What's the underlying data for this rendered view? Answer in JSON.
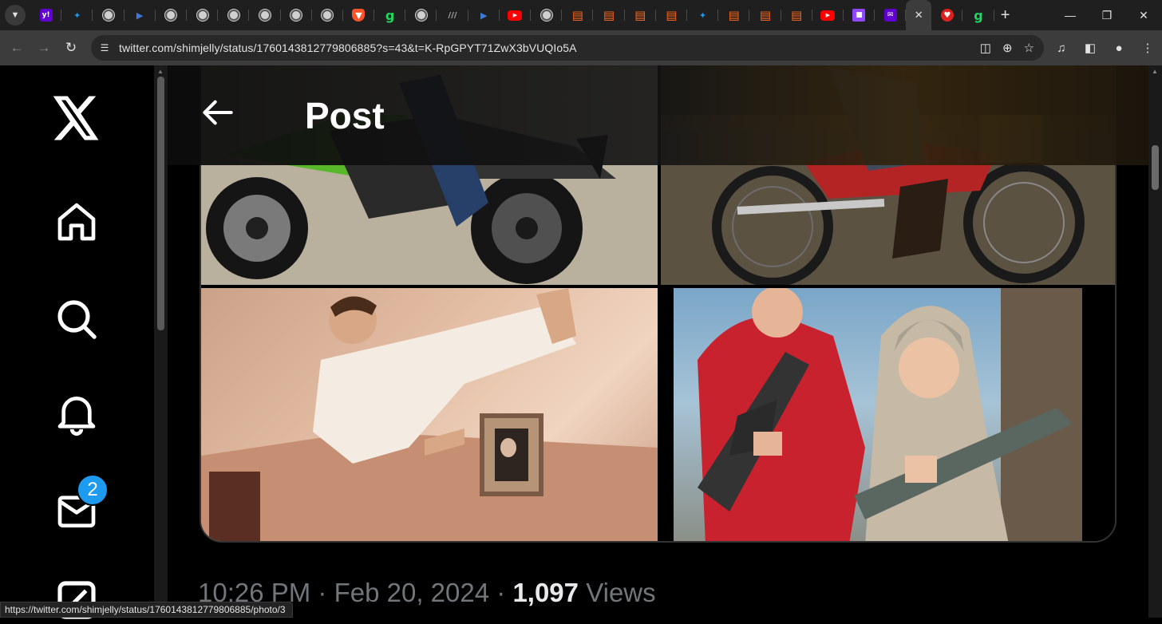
{
  "browser": {
    "tabs": [
      {
        "icon": "yahoo-icon",
        "glyph": "y!"
      },
      {
        "icon": "shield-icon",
        "glyph": "✦"
      },
      {
        "icon": "globe-icon",
        "glyph": ""
      },
      {
        "icon": "arrow-icon",
        "glyph": "▶"
      },
      {
        "icon": "globe-icon",
        "glyph": ""
      },
      {
        "icon": "globe-icon",
        "glyph": ""
      },
      {
        "icon": "globe-icon",
        "glyph": ""
      },
      {
        "icon": "globe-icon",
        "glyph": ""
      },
      {
        "icon": "globe-icon",
        "glyph": ""
      },
      {
        "icon": "globe-icon",
        "glyph": ""
      },
      {
        "icon": "brave-icon",
        "glyph": "▼"
      },
      {
        "icon": "g-icon",
        "glyph": "g"
      },
      {
        "icon": "globe-icon",
        "glyph": ""
      },
      {
        "icon": "ai-icon",
        "glyph": "///"
      },
      {
        "icon": "arrow-icon",
        "glyph": "▶"
      },
      {
        "icon": "youtube-icon",
        "glyph": "▶"
      },
      {
        "icon": "globe-icon",
        "glyph": ""
      },
      {
        "icon": "bookmark-icon",
        "glyph": "▤"
      },
      {
        "icon": "bookmark-icon",
        "glyph": "▤"
      },
      {
        "icon": "bookmark-icon",
        "glyph": "▤"
      },
      {
        "icon": "bookmark-icon",
        "glyph": "▤"
      },
      {
        "icon": "shield-icon",
        "glyph": "✦"
      },
      {
        "icon": "bookmark-icon",
        "glyph": "▤"
      },
      {
        "icon": "bookmark-icon",
        "glyph": "▤"
      },
      {
        "icon": "bookmark-icon",
        "glyph": "▤"
      },
      {
        "icon": "youtube-icon",
        "glyph": "▶"
      },
      {
        "icon": "twitch-icon",
        "glyph": "■"
      },
      {
        "icon": "mail-icon",
        "glyph": "✉"
      },
      {
        "icon": "close-icon",
        "glyph": "✕",
        "active": true
      },
      {
        "icon": "red-icon",
        "glyph": "♥"
      },
      {
        "icon": "g-icon",
        "glyph": "g"
      }
    ],
    "url": "twitter.com/shimjelly/status/1760143812779806885?s=43&t=K-RpGPYT71ZwX3bVUQIo5A",
    "status_url": "https://twitter.com/shimjelly/status/1760143812779806885/photo/3"
  },
  "sidebar": {
    "badge_count": "2"
  },
  "header": {
    "title": "Post"
  },
  "post": {
    "time": "10:26 PM",
    "separator": "·",
    "date": "Feb 20, 2024",
    "views_count": "1,097",
    "views_label": "Views"
  },
  "colors": {
    "accent": "#1d9bf0",
    "background": "#000000",
    "secondary_text": "#71767b"
  }
}
